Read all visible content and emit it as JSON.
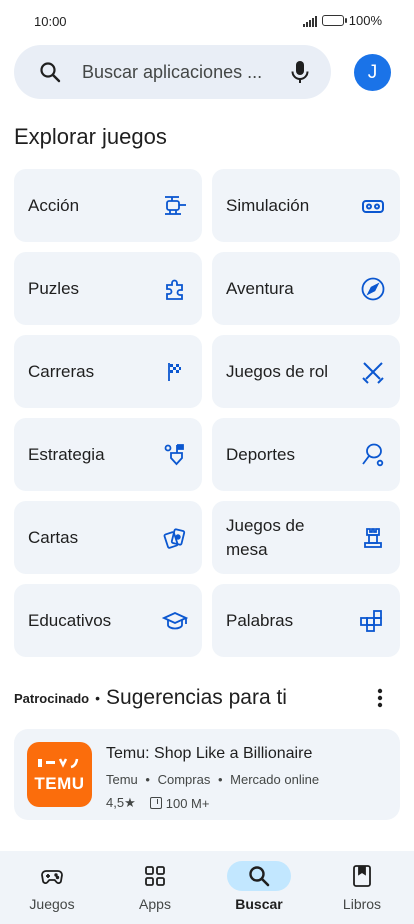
{
  "status_bar": {
    "time": "10:00",
    "battery": "100%",
    "battery_level": 1.0
  },
  "search": {
    "placeholder": "Buscar aplicaciones ...",
    "avatar_letter": "J"
  },
  "section": {
    "title": "Explorar juegos"
  },
  "categories": [
    {
      "label": "Acción",
      "icon": "helicopter-icon"
    },
    {
      "label": "Simulación",
      "icon": "vr-headset-icon"
    },
    {
      "label": "Puzles",
      "icon": "puzzle-icon"
    },
    {
      "label": "Aventura",
      "icon": "compass-icon"
    },
    {
      "label": "Carreras",
      "icon": "checkered-flag-icon"
    },
    {
      "label": "Juegos de rol",
      "icon": "crossed-swords-icon"
    },
    {
      "label": "Estrategia",
      "icon": "strategy-flag-icon"
    },
    {
      "label": "Deportes",
      "icon": "racket-icon"
    },
    {
      "label": "Cartas",
      "icon": "cards-icon"
    },
    {
      "label": "Juegos de mesa",
      "icon": "chess-rook-icon"
    },
    {
      "label": "Educativos",
      "icon": "graduation-cap-icon"
    },
    {
      "label": "Palabras",
      "icon": "word-tiles-icon"
    }
  ],
  "suggestions": {
    "sponsored": "Patrocinado",
    "separator": "•",
    "title": "Sugerencias para ti"
  },
  "app": {
    "name": "Temu: Shop Like a Billionaire",
    "developer": "Temu",
    "category": "Compras",
    "tag": "Mercado online",
    "meta_sep": "•",
    "rating": "4,5★",
    "downloads": "100 M+",
    "logo_text": "TEMU",
    "logo_color": "#fb6d0c"
  },
  "nav": [
    {
      "label": "Juegos",
      "icon": "gamepad-icon",
      "active": false
    },
    {
      "label": "Apps",
      "icon": "apps-grid-icon",
      "active": false
    },
    {
      "label": "Buscar",
      "icon": "search-icon",
      "active": true
    },
    {
      "label": "Libros",
      "icon": "bookmark-book-icon",
      "active": false
    }
  ],
  "colors": {
    "accent": "#1a73e8",
    "icon_blue": "#0b57d0",
    "card_bg": "#f0f4f9",
    "active_pill": "#c2e7ff"
  }
}
